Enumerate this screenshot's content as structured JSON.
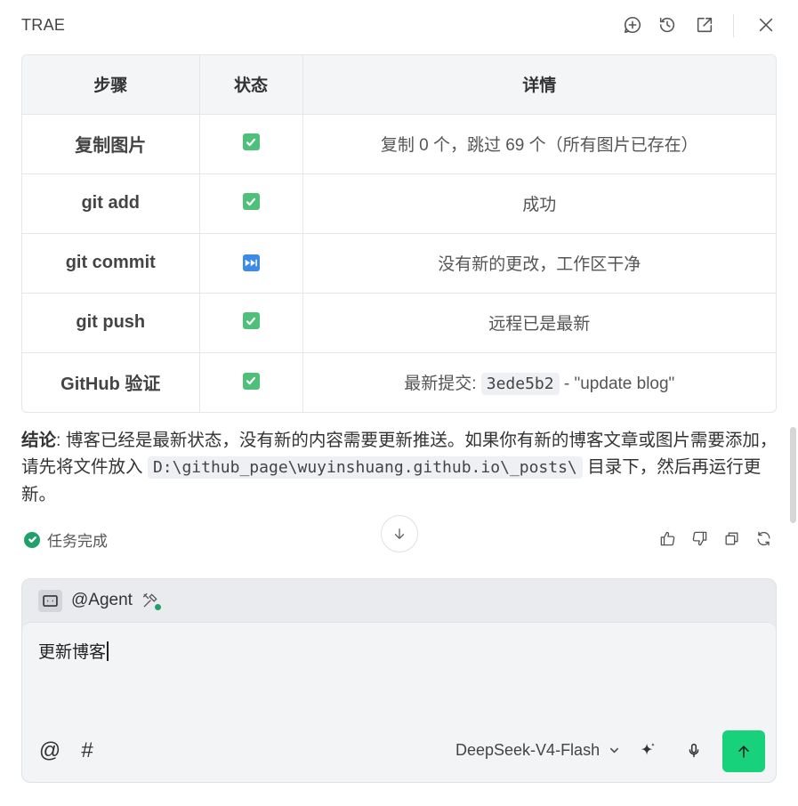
{
  "header": {
    "title": "TRAE",
    "icons": [
      "new-chat-icon",
      "history-icon",
      "open-external-icon",
      "close-icon"
    ]
  },
  "table": {
    "headers": [
      "步骤",
      "状态",
      "详情"
    ],
    "rows": [
      {
        "step": "复制图片",
        "status": "check",
        "detail": "复制 0 个，跳过 69 个（所有图片已存在）"
      },
      {
        "step": "git add",
        "status": "check",
        "detail": "成功"
      },
      {
        "step": "git commit",
        "status": "skip",
        "detail": "没有新的更改，工作区干净"
      },
      {
        "step": "git push",
        "status": "check",
        "detail": "远程已是最新"
      },
      {
        "step": "GitHub 验证",
        "status": "check",
        "detail_prefix": "最新提交:",
        "detail_code": "3ede5b2",
        "detail_suffix": "- \"update blog\""
      }
    ]
  },
  "conclusion": {
    "label": "结论",
    "text_before": ": 博客已经是最新状态，没有新的内容需要更新推送。如果你有新的博客文章或图片需要添加，请先将文件放入",
    "path": "D:\\github_page\\wuyinshuang.github.io\\_posts\\",
    "text_after": "目录下，然后再运行更新。"
  },
  "status": {
    "label": "任务完成",
    "color": "#22a06b"
  },
  "composer": {
    "agent_label": "@Agent",
    "input_value": "更新博客",
    "at_symbol": "@",
    "hash_symbol": "#",
    "model": "DeepSeek-V4-Flash",
    "send_color": "#17d27a"
  }
}
